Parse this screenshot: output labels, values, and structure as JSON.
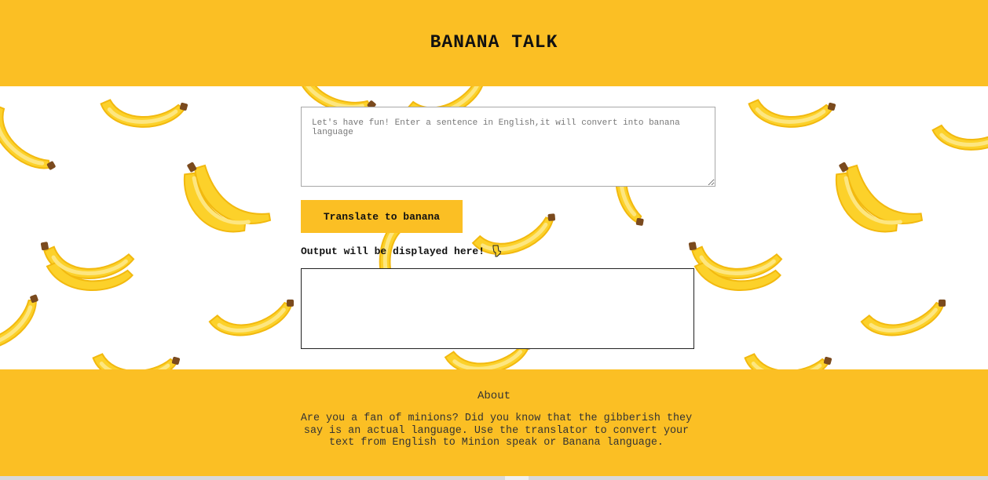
{
  "header": {
    "title": "BANANA TALK"
  },
  "translator": {
    "input_placeholder": "Let's have fun! Enter a sentence in English,it will convert into banana language",
    "input_value": "",
    "button_label": "Translate to banana",
    "output_label": "Output will be displayed here!",
    "output_value": ""
  },
  "footer": {
    "heading": "About",
    "description": "Are you a fan of minions? Did you know that the gibberish they say is an actual language. Use the translator to convert your text from English to Minion speak or Banana language."
  },
  "colors": {
    "accent": "#fbbf24",
    "banana": "#fcd12a",
    "banana_shade": "#f2b90f",
    "banana_highlight": "#fde680",
    "banana_stem": "#7a4a1e"
  },
  "icons": {
    "output_pointer": "pointing-hand-down-icon",
    "background": "banana-icon"
  }
}
